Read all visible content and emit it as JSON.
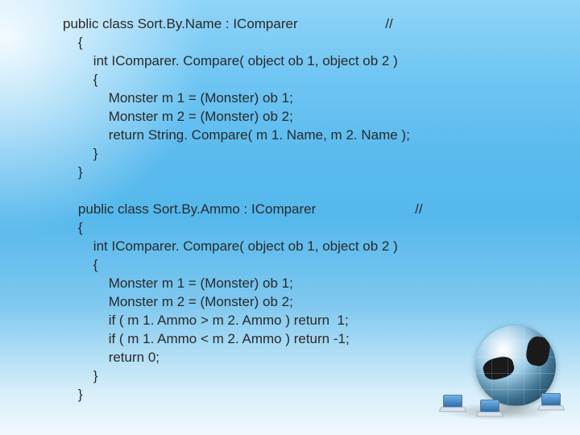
{
  "block1": {
    "l1": "public class Sort.By.Name : IComparer",
    "cmt": "//",
    "l2": "{",
    "l3": "int IComparer. Compare( object ob 1, object ob 2 )",
    "l4": "{",
    "l5": "Monster m 1 = (Monster) ob 1;",
    "l6": "Monster m 2 = (Monster) ob 2;",
    "l7": "return String. Compare( m 1. Name, m 2. Name );",
    "l8": "}",
    "l9": "}"
  },
  "block2": {
    "l1": "public class Sort.By.Ammo : IComparer",
    "cmt": "//",
    "l2": "{",
    "l3": "int IComparer. Compare( object ob 1, object ob 2 )",
    "l4": "{",
    "l5": "Monster m 1 = (Monster) ob 1;",
    "l6": "Monster m 2 = (Monster) ob 2;",
    "l7": "if ( m 1. Ammo > m 2. Ammo ) return  1;",
    "l8": "if ( m 1. Ammo < m 2. Ammo ) return -1;",
    "l9": "return 0;",
    "l10": "}",
    "l11": "}"
  }
}
